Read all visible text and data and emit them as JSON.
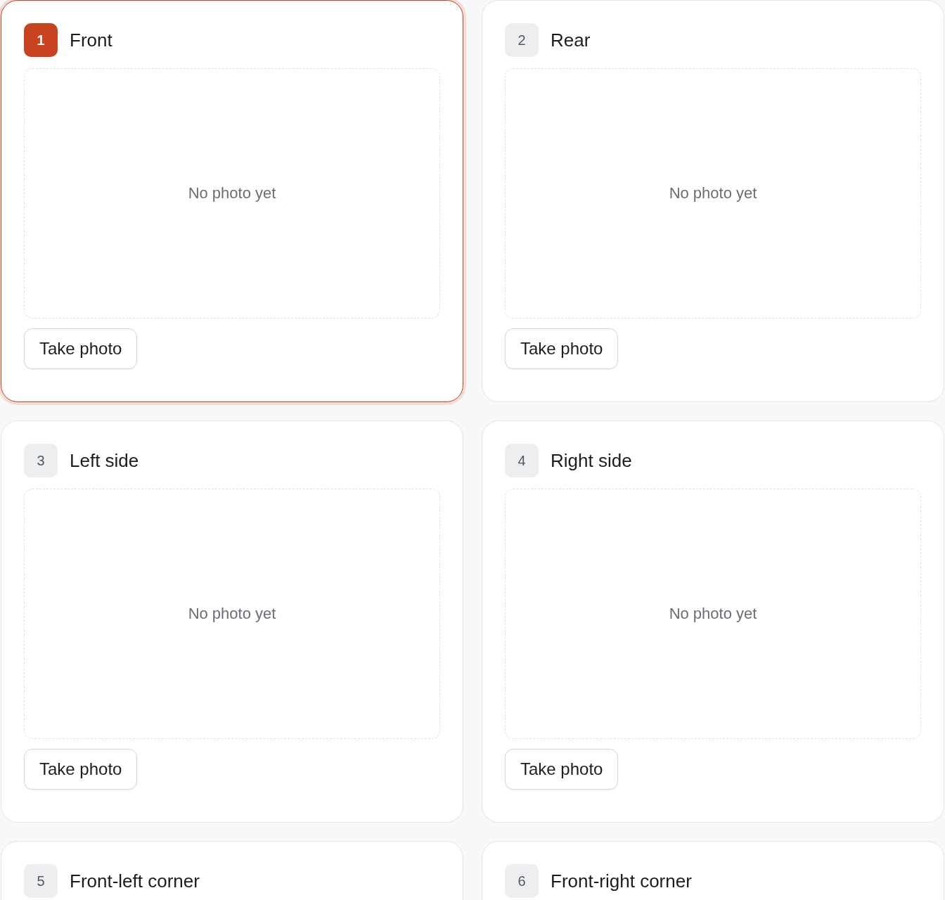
{
  "cards": [
    {
      "number": "1",
      "title": "Front",
      "selected": true,
      "placeholder": "No photo yet",
      "button": "Take photo"
    },
    {
      "number": "2",
      "title": "Rear",
      "selected": false,
      "placeholder": "No photo yet",
      "button": "Take photo"
    },
    {
      "number": "3",
      "title": "Left side",
      "selected": false,
      "placeholder": "No photo yet",
      "button": "Take photo"
    },
    {
      "number": "4",
      "title": "Right side",
      "selected": false,
      "placeholder": "No photo yet",
      "button": "Take photo"
    },
    {
      "number": "5",
      "title": "Front-left corner",
      "selected": false
    },
    {
      "number": "6",
      "title": "Front-right corner",
      "selected": false
    }
  ]
}
